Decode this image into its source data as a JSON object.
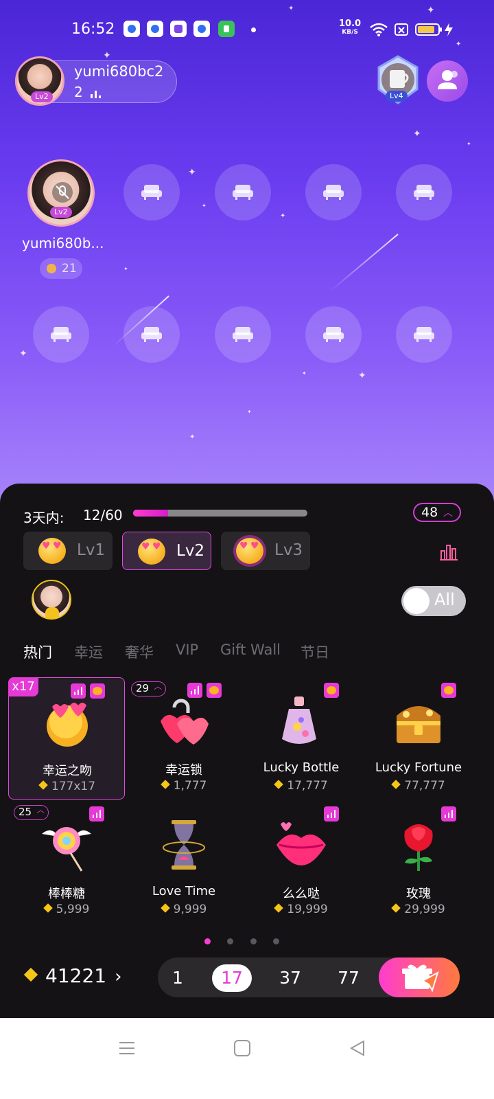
{
  "status_bar": {
    "time": "16:52",
    "net_speed": "10.0",
    "net_unit": "KB/S",
    "notification_icons": [
      "qq-icon",
      "baidu-icon",
      "app-icon",
      "qq-icon",
      "shield-icon"
    ],
    "icons": [
      "wifi-icon",
      "sim-off-icon",
      "battery-icon",
      "charging-icon"
    ]
  },
  "room": {
    "owner_name": "yumi680bc2",
    "owner_level": "Lv2",
    "owner_count": "2",
    "badge_level": "Lv4",
    "host_name": "yumi680b...",
    "host_level": "Lv2",
    "host_score": "21"
  },
  "panel": {
    "intimacy_label": "3天内:",
    "intimacy_value": "12/60",
    "intimacy_progress": 0.2,
    "level_badge": "48",
    "level_tabs": [
      {
        "label": "Lv1"
      },
      {
        "label": "Lv2"
      },
      {
        "label": "Lv3"
      }
    ],
    "toggle_label": "All",
    "tabs": [
      "热门",
      "幸运",
      "奢华",
      "VIP",
      "Gift Wall",
      "节日"
    ],
    "active_tab": "热门"
  },
  "gifts": [
    {
      "name": "幸运之吻",
      "price": "177x17",
      "x_badge": "x17",
      "count_badge": ""
    },
    {
      "name": "幸运锁",
      "price": "1,777",
      "x_badge": "",
      "count_badge": "29"
    },
    {
      "name": "Lucky Bottle",
      "price": "17,777",
      "x_badge": "",
      "count_badge": ""
    },
    {
      "name": "Lucky Fortune",
      "price": "77,777",
      "x_badge": "",
      "count_badge": ""
    },
    {
      "name": "棒棒糖",
      "price": "5,999",
      "x_badge": "",
      "count_badge": "25"
    },
    {
      "name": "Love Time",
      "price": "9,999",
      "x_badge": "",
      "count_badge": ""
    },
    {
      "name": "么么哒",
      "price": "19,999",
      "x_badge": "",
      "count_badge": ""
    },
    {
      "name": "玫瑰",
      "price": "29,999",
      "x_badge": "",
      "count_badge": ""
    }
  ],
  "footer": {
    "balance": "41221",
    "quantities": [
      "1",
      "17",
      "37",
      "77"
    ],
    "selected_quantity": "17"
  },
  "colors": {
    "accent": "#e63ad6",
    "panel_bg": "#141214",
    "room_top": "#4a26d6",
    "room_bottom": "#a885fb"
  }
}
